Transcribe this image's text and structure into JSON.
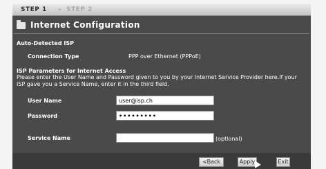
{
  "steps": {
    "step1": "STEP 1",
    "separator": "»",
    "step2": "STEP 2"
  },
  "header": {
    "title": "Internet Configuration",
    "icon": "folder-icon"
  },
  "auto_detected": {
    "heading": "Auto-Detected ISP",
    "connection_type_label": "Connection Type",
    "connection_type_value": "PPP over Ethernet (PPPoE)"
  },
  "isp_params": {
    "heading": "ISP Parameters for Internet Access",
    "description": "Please enter the User Name and Password given to you by your Internet Service Provider here.If your ISP gave you a Service Name, enter it in the third field.",
    "user_name_label": "User Name",
    "user_name_value": "user@isp.ch",
    "password_label": "Password",
    "password_value": "•••••••••",
    "service_name_label": "Service Name",
    "service_name_value": "",
    "optional_note": "(optional)"
  },
  "buttons": {
    "back": "<Back",
    "apply": "Apply",
    "exit": "Exit"
  }
}
